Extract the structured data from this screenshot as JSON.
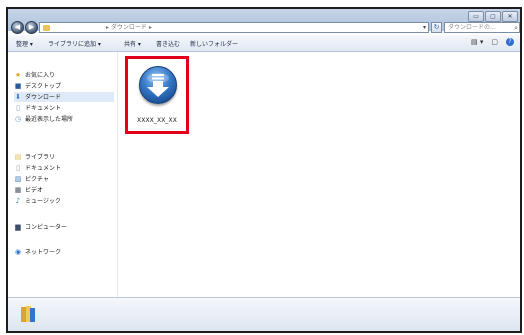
{
  "window": {
    "controls": {
      "minimize": "▭",
      "maximize": "▢",
      "close": "✕"
    }
  },
  "nav": {
    "back": "◀",
    "forward": "▶"
  },
  "address": {
    "path": "▸ ダウンロード ▸",
    "dropdown": "▾"
  },
  "refresh": "↻",
  "search": {
    "placeholder": "ダウンロードの...",
    "icon": "search-icon"
  },
  "toolbar": {
    "organize": "整理 ▾",
    "add_to_library": "ライブラリに追加 ▾",
    "share": "共有 ▾",
    "burn": "書き込む",
    "new_folder": "新しいフォルダー",
    "view_icon": "▤ ▾",
    "pane_icon": "▢",
    "help": "?"
  },
  "sidebar": {
    "favorites": {
      "label": "お気に入り",
      "items": [
        {
          "label": "デスクトップ"
        },
        {
          "label": "ダウンロード",
          "selected": true
        },
        {
          "label": "ドキュメント"
        },
        {
          "label": "最近表示した場所"
        }
      ]
    },
    "libraries": {
      "label": "ライブラリ",
      "items": [
        {
          "label": "ドキュメント"
        },
        {
          "label": "ピクチャ"
        },
        {
          "label": "ビデオ"
        },
        {
          "label": "ミュージック"
        }
      ]
    },
    "computer": "コンピューター",
    "network": "ネットワーク"
  },
  "content": {
    "files": [
      {
        "name": "XXXX_XX_XX",
        "icon": "download-installer-icon",
        "highlight_color": "#e1001a"
      }
    ]
  },
  "colors": {
    "highlight": "#e1001a",
    "selection": "#dfeaf8",
    "accent": "#3577c7"
  }
}
